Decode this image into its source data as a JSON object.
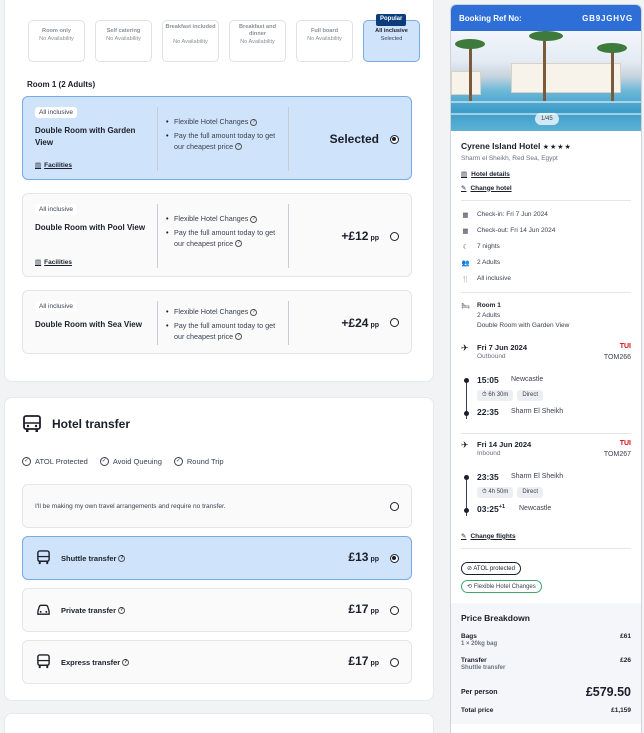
{
  "board_options": [
    {
      "name": "Room only",
      "availability": "No Availability"
    },
    {
      "name": "Self catering",
      "availability": "No Availability"
    },
    {
      "name": "Breakfast included",
      "availability": "No Availability"
    },
    {
      "name": "Breakfast and dinner",
      "availability": "No Availability"
    },
    {
      "name": "Full board",
      "availability": "No Availability"
    },
    {
      "name": "All inclusive",
      "availability": "Selected",
      "tag": "Popular"
    }
  ],
  "room_heading": "Room 1 (2 Adults)",
  "rooms": [
    {
      "badge": "All inclusive",
      "name": "Double Room with Garden View",
      "facilities": "Facilities",
      "feature1": "Flexible Hotel Changes",
      "feature2": "Pay the full amount today to get our cheapest price",
      "price": "Selected",
      "price_unit": ""
    },
    {
      "badge": "All inclusive",
      "name": "Double Room with Pool View",
      "facilities": "Facilities",
      "feature1": "Flexible Hotel Changes",
      "feature2": "Pay the full amount today to get our cheapest price",
      "price": "+£12",
      "price_unit": "pp"
    },
    {
      "badge": "All inclusive",
      "name": "Double Room with Sea View",
      "feature1": "Flexible Hotel Changes",
      "feature2": "Pay the full amount today to get our cheapest price",
      "price": "+£24",
      "price_unit": "pp"
    }
  ],
  "transfer": {
    "title": "Hotel transfer",
    "features": [
      "ATOL Protected",
      "Avoid Queuing",
      "Round Trip"
    ],
    "none_option": "I'll be making my own travel arrangements and require no transfer.",
    "options": [
      {
        "name": "Shuttle transfer",
        "price": "£13",
        "unit": "pp"
      },
      {
        "name": "Private transfer",
        "price": "£17",
        "unit": "pp"
      },
      {
        "name": "Express transfer",
        "price": "£17",
        "unit": "pp"
      }
    ]
  },
  "sidebar": {
    "ref_label": "Booking Ref No:",
    "ref_value": "GB9JGHVG",
    "photo_count": "1/45",
    "hotel_name": "Cyrene Island Hotel",
    "stars": "★★★★",
    "location": "Sharm el Sheikh, Red Sea, Egypt",
    "hotel_details": "Hotel details",
    "change_hotel": "Change hotel",
    "checkin": "Check-in: Fri 7 Jun 2024",
    "checkout": "Check-out: Fri 14 Jun 2024",
    "nights": "7 nights",
    "adults": "2 Adults",
    "board": "All inclusive",
    "room_label": "Room 1",
    "room_adults": "2 Adults",
    "room_type": "Double Room with Garden View",
    "outbound": {
      "date": "Fri 7 Jun 2024",
      "dir": "Outbound",
      "airline": "TUI",
      "flight_no": "TOM266",
      "dep_time": "15:05",
      "dep_airport": "Newcastle",
      "duration": "6h 30m",
      "stops": "Direct",
      "arr_time": "22:35",
      "arr_airport": "Sharm El Sheikh"
    },
    "inbound": {
      "date": "Fri 14 Jun 2024",
      "dir": "Inbound",
      "airline": "TUI",
      "flight_no": "TOM267",
      "dep_time": "23:35",
      "dep_airport": "Sharm El Sheikh",
      "duration": "4h 50m",
      "stops": "Direct",
      "arr_time": "03:25",
      "arr_sup": "+1",
      "arr_airport": "Newcastle"
    },
    "change_flights": "Change flights",
    "atol": "ATOL protected",
    "flex": "Flexible Hotel Changes",
    "price": {
      "title": "Price Breakdown",
      "bags_label": "Bags",
      "bags_sub": "1 × 20kg bag",
      "bags_value": "£61",
      "transfer_label": "Transfer",
      "transfer_sub": "Shuttle transfer",
      "transfer_value": "£26",
      "per_person_label": "Per person",
      "per_person_value": "£579.50",
      "total_label": "Total price",
      "total_value": "£1,159"
    }
  }
}
